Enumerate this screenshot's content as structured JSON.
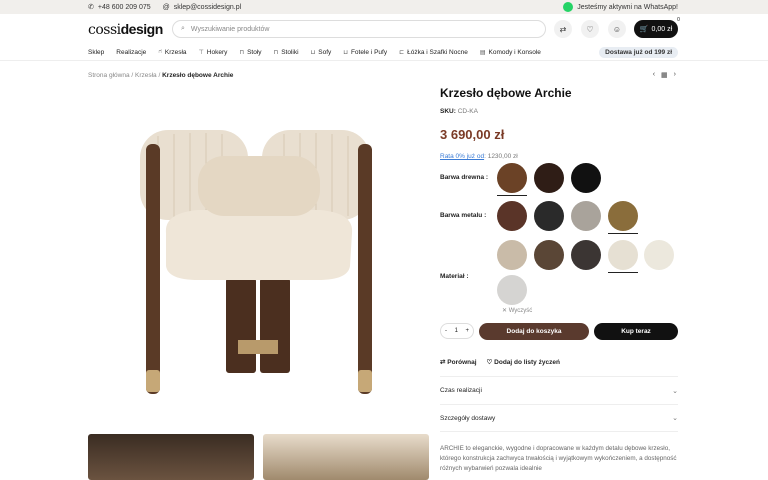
{
  "topbar": {
    "phone": "+48 600 209 075",
    "email": "sklep@cossidesign.pl",
    "whatsapp": "Jesteśmy aktywni na WhatsApp!"
  },
  "header": {
    "logo_part1": "cossi",
    "logo_part2": "design",
    "search_placeholder": "Wyszukiwanie produktów",
    "cart_total": "0,00 zł",
    "cart_count": "0"
  },
  "nav": {
    "items": [
      "Sklep",
      "Realizacje",
      "Krzesła",
      "Hokery",
      "Stoły",
      "Stoliki",
      "Sofy",
      "Fotele i Pufy",
      "Łóżka i Szafki Nocne",
      "Komody i Konsole"
    ],
    "delivery": "Dostawa już od 199 zł"
  },
  "breadcrumb": {
    "home": "Strona główna",
    "category": "Krzesła",
    "current": "Krzesło dębowe Archie"
  },
  "product": {
    "title": "Krzesło dębowe Archie",
    "sku_label": "SKU:",
    "sku": "CD-KA",
    "price": "3 690,00 zł",
    "rata_link": "Rata 0% już od",
    "rata_value": ": 1230,00 zł",
    "wood_label": "Barwa drewna :",
    "metal_label": "Barwa metalu :",
    "material_label": "Materiał :",
    "clear": "✕ Wyczyść",
    "qty": "1",
    "qty_minus": "-",
    "qty_plus": "+",
    "add_to_cart": "Dodaj do koszyka",
    "buy_now": "Kup teraz",
    "compare": "Porównaj",
    "wishlist": "Dodaj do listy życzeń",
    "acc_time": "Czas realizacji",
    "acc_delivery": "Szczegóły dostawy",
    "description": "ARCHIE to eleganckie, wygodne i dopracowane w każdym detalu dębowe krzesło, którego konstrukcja zachwyca trwałością i wyjątkowym wykończeniem, a dostępność różnych wybarwień pozwala idealnie"
  },
  "colors": {
    "wood": [
      "#6b4226",
      "#2f1d16",
      "#111111"
    ],
    "metal": [
      "#5a3428",
      "#2a2a2a",
      "#a9a39b",
      "#8a6d3b"
    ],
    "material": [
      "#c9bba8",
      "#5a4636",
      "#3b3533",
      "#e6e0d3",
      "#ece8dd",
      "#d5d4d2"
    ]
  }
}
